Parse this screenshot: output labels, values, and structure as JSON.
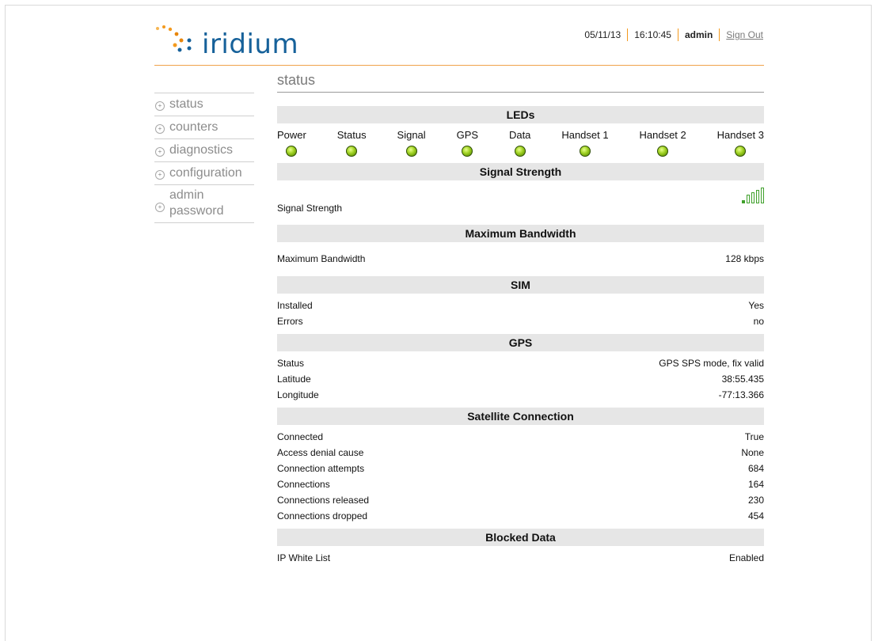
{
  "brand": {
    "name": "iridium",
    "color": "#16619a",
    "accent": "#f39a1e"
  },
  "topbar": {
    "date": "05/11/13",
    "time": "16:10:45",
    "user": "admin",
    "sign_out": "Sign Out"
  },
  "sidebar": {
    "items": [
      {
        "label": "status"
      },
      {
        "label": "counters"
      },
      {
        "label": "diagnostics"
      },
      {
        "label": "configuration"
      },
      {
        "label": "admin password"
      }
    ]
  },
  "page": {
    "title": "status"
  },
  "leds": {
    "heading": "LEDs",
    "items": [
      "Power",
      "Status",
      "Signal",
      "GPS",
      "Data",
      "Handset 1",
      "Handset 2",
      "Handset 3"
    ],
    "color": "#9ed021"
  },
  "signal": {
    "heading": "Signal Strength",
    "label": "Signal Strength",
    "bars_active": 1,
    "bars_total": 5
  },
  "bandwidth": {
    "heading": "Maximum Bandwidth",
    "label": "Maximum Bandwidth",
    "value": "128 kbps"
  },
  "sim": {
    "heading": "SIM",
    "rows": [
      {
        "label": "Installed",
        "value": "Yes"
      },
      {
        "label": "Errors",
        "value": "no"
      }
    ]
  },
  "gps": {
    "heading": "GPS",
    "rows": [
      {
        "label": "Status",
        "value": "GPS SPS mode, fix valid"
      },
      {
        "label": "Latitude",
        "value": "38:55.435"
      },
      {
        "label": "Longitude",
        "value": "-77:13.366"
      }
    ]
  },
  "satellite": {
    "heading": "Satellite Connection",
    "rows": [
      {
        "label": "Connected",
        "value": "True"
      },
      {
        "label": "Access denial cause",
        "value": "None"
      },
      {
        "label": "Connection attempts",
        "value": "684"
      },
      {
        "label": "Connections",
        "value": "164"
      },
      {
        "label": "Connections released",
        "value": "230"
      },
      {
        "label": "Connections dropped",
        "value": "454"
      }
    ]
  },
  "blocked": {
    "heading": "Blocked Data",
    "rows": [
      {
        "label": "IP White List",
        "value": "Enabled"
      }
    ]
  }
}
